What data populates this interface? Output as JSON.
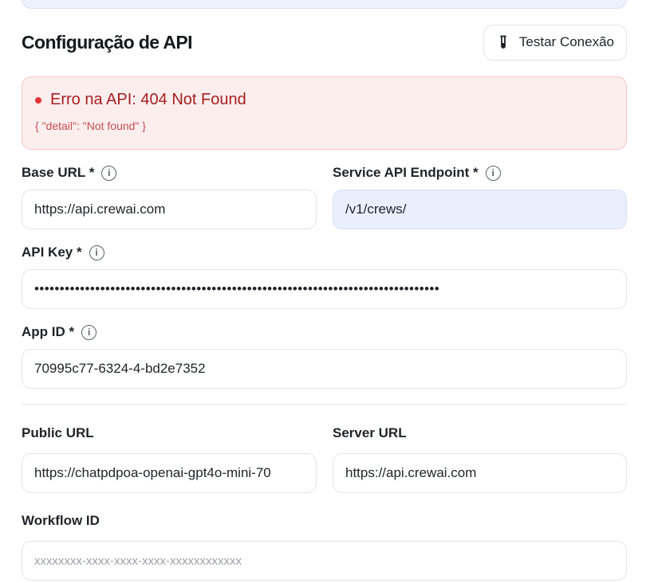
{
  "header": {
    "title": "Configuração de API",
    "test_button_label": "Testar Conexão"
  },
  "error": {
    "title": "Erro na API: 404 Not Found",
    "detail": "{ \"detail\": \"Not found\" }"
  },
  "fields": {
    "base_url": {
      "label": "Base URL *",
      "value": "https://api.crewai.com"
    },
    "service_endpoint": {
      "label": "Service API Endpoint *",
      "value": "/v1/crews/"
    },
    "api_key": {
      "label": "API Key *",
      "value": "••••••••••••••••••••••••••••••••••••••••••••••••••••••••••••••••••••••••••••••••"
    },
    "app_id": {
      "label": "App ID *",
      "value": "70995c77-6324-4-bd2e7352"
    },
    "public_url": {
      "label": "Public URL",
      "value": "https://chatpdpoa-openai-gpt4o-mini-70"
    },
    "server_url": {
      "label": "Server URL",
      "value": "https://api.crewai.com"
    },
    "workflow_id": {
      "label": "Workflow ID",
      "placeholder": "xxxxxxxx-xxxx-xxxx-xxxx-xxxxxxxxxxxx"
    }
  },
  "icons": {
    "info": "i",
    "test": "test-tube-icon"
  },
  "colors": {
    "error_bg": "#fdeeee",
    "error_text": "#a61e1e",
    "highlight_input": "#e9effd"
  }
}
